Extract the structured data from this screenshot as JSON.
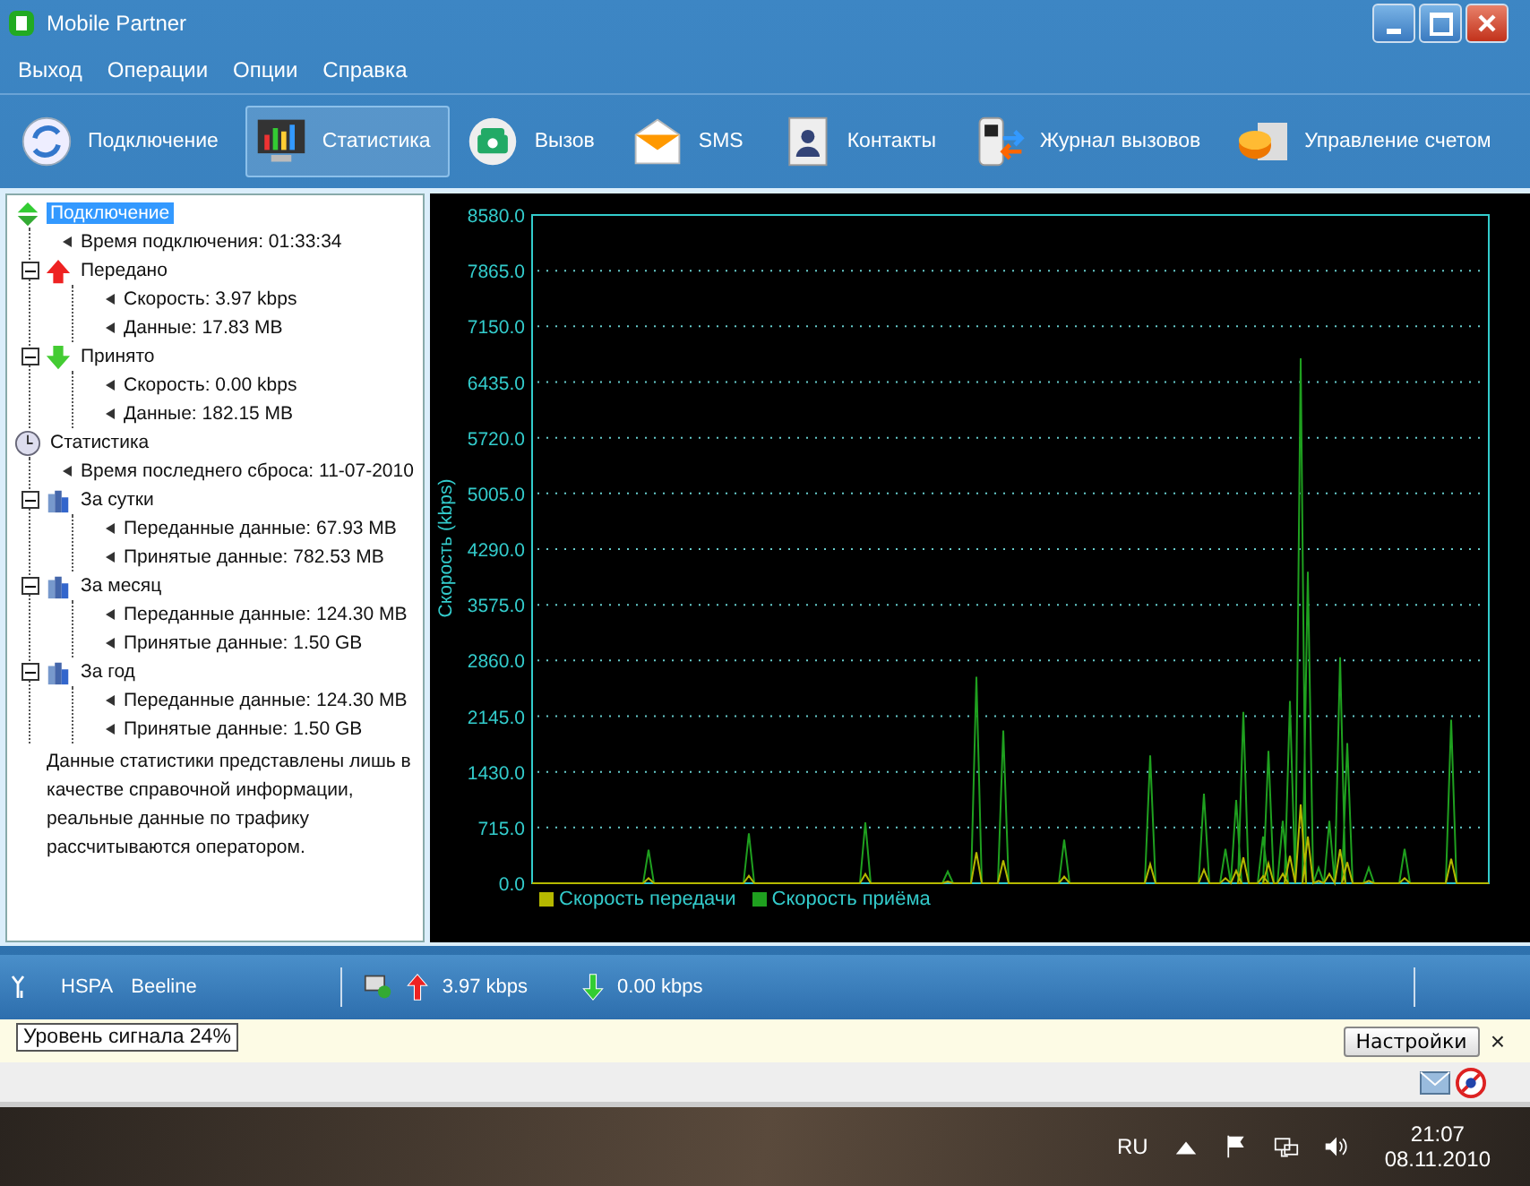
{
  "window": {
    "title": "Mobile Partner"
  },
  "menu": [
    "Выход",
    "Операции",
    "Опции",
    "Справка"
  ],
  "toolbar": [
    {
      "label": "Подключение",
      "kind": "connect",
      "selected": false
    },
    {
      "label": "Статистика",
      "kind": "stats",
      "selected": true
    },
    {
      "label": "Вызов",
      "kind": "call",
      "selected": false
    },
    {
      "label": "SMS",
      "kind": "sms",
      "selected": false
    },
    {
      "label": "Контакты",
      "kind": "contacts",
      "selected": false
    },
    {
      "label": "Журнал вызовов",
      "kind": "log",
      "selected": false
    },
    {
      "label": "Управление счетом",
      "kind": "account",
      "selected": false
    }
  ],
  "tree": [
    {
      "label": "Подключение",
      "kind": "connection",
      "selected": true,
      "expanded": true,
      "children": [
        {
          "label": "Время подключения: 01:33:34",
          "selected": false
        },
        {
          "label": "Передано",
          "kind": "up",
          "selected": false,
          "expanded": true,
          "children": [
            {
              "label": "Скорость: 3.97 kbps",
              "selected": false
            },
            {
              "label": "Данные: 17.83 MB",
              "selected": false
            }
          ]
        },
        {
          "label": "Принято",
          "kind": "down",
          "selected": false,
          "expanded": true,
          "children": [
            {
              "label": "Скорость: 0.00 kbps",
              "selected": false
            },
            {
              "label": "Данные: 182.15 MB",
              "selected": false
            }
          ]
        }
      ]
    },
    {
      "label": "Статистика",
      "kind": "clock",
      "selected": false,
      "expanded": true,
      "children": [
        {
          "label": "Время последнего сброса: 11-07-2010",
          "selected": false
        },
        {
          "label": "За сутки",
          "kind": "period",
          "selected": false,
          "expanded": true,
          "children": [
            {
              "label": "Переданные данные: 67.93 MB",
              "selected": false
            },
            {
              "label": "Принятые данные: 782.53 MB",
              "selected": false
            }
          ]
        },
        {
          "label": "За месяц",
          "kind": "period",
          "selected": false,
          "expanded": true,
          "children": [
            {
              "label": "Переданные данные: 124.30 MB",
              "selected": false
            },
            {
              "label": "Принятые данные: 1.50 GB",
              "selected": false
            }
          ]
        },
        {
          "label": "За год",
          "kind": "period",
          "selected": false,
          "expanded": true,
          "children": [
            {
              "label": "Переданные данные: 124.30 MB",
              "selected": false
            },
            {
              "label": "Принятые данные: 1.50 GB",
              "selected": false
            }
          ]
        }
      ]
    }
  ],
  "note": "Данные статистики представлены лишь в качестве справочной информации, реальные данные по трафику рассчитываются оператором.",
  "graph": {
    "ylabel": "Скорость (kbps)",
    "yticks": [
      "8580.0",
      "7865.0",
      "7150.0",
      "6435.0",
      "5720.0",
      "5005.0",
      "4290.0",
      "3575.0",
      "2860.0",
      "2145.0",
      "1430.0",
      "715.0",
      "0.0"
    ],
    "legend": [
      {
        "label": "Скорость передачи",
        "color": "#b5b800"
      },
      {
        "label": "Скорость приёма",
        "color": "#1fa01f"
      }
    ]
  },
  "status_bar": {
    "network": "HSPA",
    "operator": "Beeline",
    "upload": "3.97 kbps",
    "download": "0.00 kbps"
  },
  "notification": {
    "button": "Настройки",
    "close": "×",
    "tooltip": "Уровень сигнала 24%"
  },
  "taskbar": {
    "language": "RU",
    "time": "21:07",
    "date": "08.11.2010"
  }
}
